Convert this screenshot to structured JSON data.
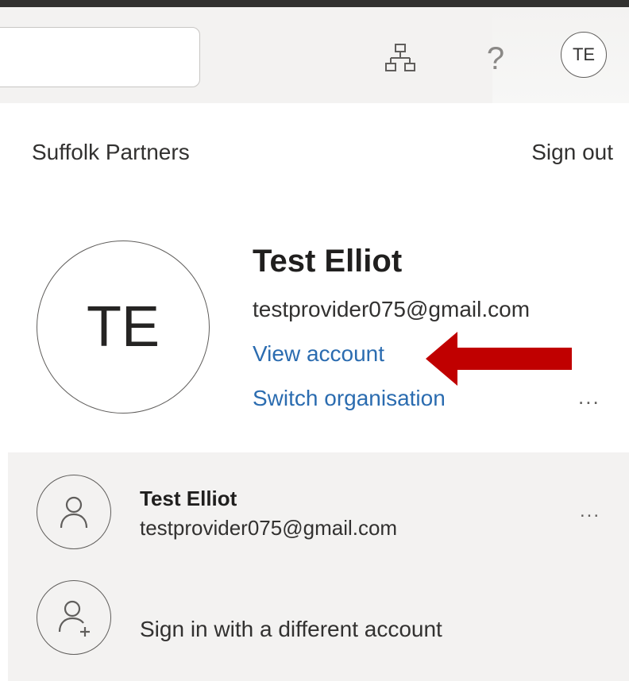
{
  "header": {
    "search_value": "",
    "org_switch_icon": "org-chart-icon",
    "help_glyph": "?",
    "avatar_initials": "TE"
  },
  "account_manager": {
    "org_name": "Suffolk Partners",
    "sign_out_label": "Sign out",
    "current_user": {
      "initials": "TE",
      "name": "Test Elliot",
      "email": "testprovider075@gmail.com",
      "view_account_label": "View account",
      "switch_org_label": "Switch organisation",
      "more_label": "..."
    },
    "other_accounts": [
      {
        "name": "Test Elliot",
        "email": "testprovider075@gmail.com",
        "icon": "person-icon",
        "more_label": "..."
      }
    ],
    "add_account": {
      "label": "Sign in with a different account",
      "icon": "person-add-icon"
    }
  },
  "annotation": {
    "arrow_color": "#c00000",
    "points_to": "View account"
  },
  "colors": {
    "link": "#2b6cb0",
    "header_bg": "#f3f2f1",
    "accounts_bg": "#f3f2f1"
  }
}
